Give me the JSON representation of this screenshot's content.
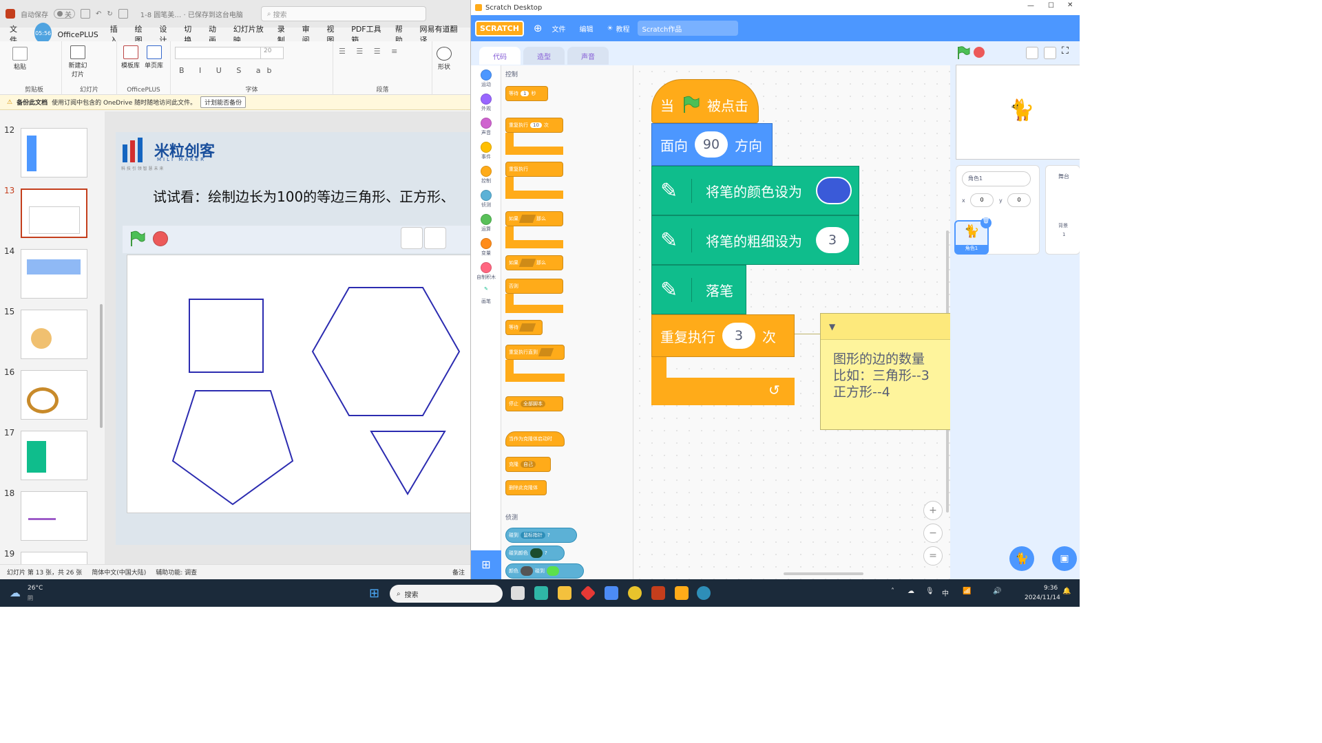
{
  "ppt": {
    "autosave_label": "自动保存",
    "autosave_state": "关",
    "file_name": "1-8 圆笔美… · 已保存到这台电脑",
    "search_placeholder": "搜索",
    "menu": [
      "文件",
      "OfficePLUS",
      "插入",
      "绘图",
      "设计",
      "切换",
      "动画",
      "幻灯片放映",
      "录制",
      "审阅",
      "视图",
      "PDF工具箱",
      "帮助",
      "网易有道翻译"
    ],
    "time_badge": "05:56",
    "ribbon_groups": [
      "剪贴板",
      "幻灯片",
      "OfficePLUS",
      "字体",
      "段落"
    ],
    "ribbon_buttons": {
      "paste": "粘贴",
      "new_slide": "新建幻灯片",
      "template": "模板库",
      "single": "单页库",
      "shape": "形状"
    },
    "font_size": "20",
    "notice_title": "备份此文档",
    "notice_text": "使用订阅中包含的 OneDrive 随时随地访问此文件。",
    "notice_button": "计划能否备份",
    "thumbs": [
      {
        "num": "12",
        "star": "*"
      },
      {
        "num": "13",
        "star": ""
      },
      {
        "num": "14",
        "star": ""
      },
      {
        "num": "15",
        "star": "*"
      },
      {
        "num": "16",
        "star": ""
      },
      {
        "num": "17",
        "star": ""
      },
      {
        "num": "18",
        "star": ""
      },
      {
        "num": "19",
        "star": ""
      }
    ],
    "slide": {
      "logo_cn": "米粒创客",
      "logo_en": "MILI MAKER",
      "logo_tag": "科 技 引 领 智 慧 未 来",
      "heading": "试试看：绘制边长为100的等边三角形、正方形、"
    },
    "status": {
      "slide_info": "幻灯片 第 13 张，共 26 张",
      "language": "简体中文(中国大陆)",
      "accessibility": "辅助功能: 调查",
      "notes": "备注"
    }
  },
  "scratch": {
    "window_title": "Scratch Desktop",
    "menu": {
      "logo": "SCRATCH",
      "file": "文件",
      "edit": "编辑",
      "tutorials": "教程",
      "project_title": "Scratch作品"
    },
    "tabs": [
      "代码",
      "造型",
      "声音"
    ],
    "categories": [
      {
        "label": "运动",
        "color": "#4c97ff"
      },
      {
        "label": "外观",
        "color": "#9966ff"
      },
      {
        "label": "声音",
        "color": "#cf63cf"
      },
      {
        "label": "事件",
        "color": "#ffbf00"
      },
      {
        "label": "控制",
        "color": "#ffab19"
      },
      {
        "label": "侦测",
        "color": "#5cb1d6"
      },
      {
        "label": "运算",
        "color": "#59c059"
      },
      {
        "label": "变量",
        "color": "#ff8c1a"
      },
      {
        "label": "自制积木",
        "color": "#ff6680"
      },
      {
        "label": "画笔",
        "color": "#0fbd8c"
      }
    ],
    "palette": {
      "section_control": "控制",
      "wait": "等待",
      "wait_val": "1",
      "wait_unit": "秒",
      "repeat": "重复执行",
      "repeat_val": "10",
      "repeat_unit": "次",
      "forever": "重复执行",
      "if_then": "如果",
      "then": "那么",
      "if_else_if": "如果",
      "else_then": "那么",
      "else": "否则",
      "wait_until": "等待",
      "repeat_until": "重复执行直到",
      "stop": "停止",
      "stop_opt": "全部脚本",
      "clone_start": "当作为克隆体启动时",
      "clone": "克隆",
      "clone_opt": "自己",
      "delete_clone": "删除此克隆体",
      "section_sensing": "侦测",
      "touching": "碰到",
      "touching_opt": "鼠标指针",
      "touching_color": "碰到颜色",
      "color_touch_a": "颜色",
      "color_touch_b": "碰到"
    },
    "script": {
      "hat_when": "当",
      "hat_clicked": "被点击",
      "point_a": "面向",
      "point_val": "90",
      "point_b": "方向",
      "pen_color": "将笔的颜色设为",
      "pen_color_hex": "#3a5ad8",
      "pen_size": "将笔的粗细设为",
      "pen_size_val": "3",
      "pen_down": "落笔",
      "repeat_a": "重复执行",
      "repeat_val": "3",
      "repeat_b": "次"
    },
    "comment": "图形的边的数量\n比如：三角形--3\n正方形--4",
    "sprite_panel": {
      "name_label": "角色1",
      "x_label": "x",
      "x_val": "0",
      "y_label": "y",
      "y_val": "0",
      "sprite_name": "角色1",
      "stage_label": "舞台",
      "backdrops_label": "背景",
      "backdrops_count": "1"
    }
  },
  "taskbar": {
    "weather_temp": "26°C",
    "weather_desc": "阴",
    "search_placeholder": "搜索",
    "ime": "中",
    "time": "9:36",
    "date": "2024/11/14"
  }
}
